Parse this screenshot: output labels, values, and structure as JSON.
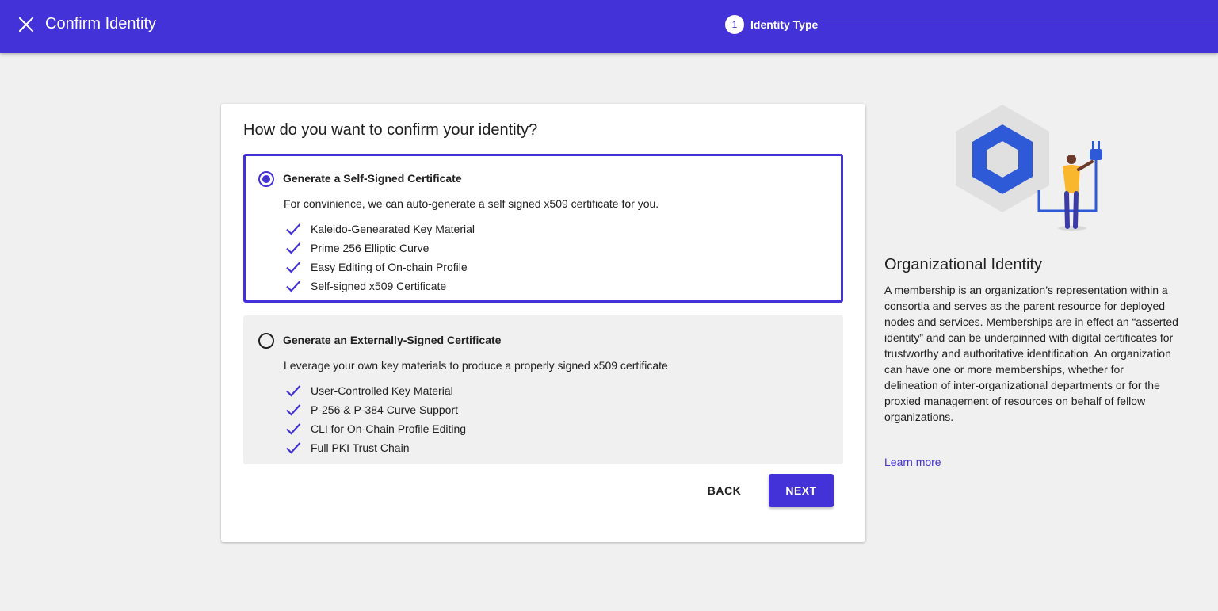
{
  "header": {
    "title": "Confirm Identity",
    "close_icon": "close-icon",
    "step": {
      "number": "1",
      "label": "Identity Type"
    }
  },
  "card": {
    "title": "How do you want to confirm your identity?",
    "options": [
      {
        "title": "Generate a Self-Signed Certificate",
        "description": "For convinience, we can auto-generate a self signed x509 certificate for you.",
        "selected": true,
        "features": [
          "Kaleido-Genearated Key Material",
          "Prime 256 Elliptic Curve",
          "Easy Editing of On-chain Profile",
          "Self-signed x509 Certificate"
        ]
      },
      {
        "title": "Generate an Externally-Signed Certificate",
        "description": "Leverage your own key materials to produce a properly signed x509 certificate",
        "selected": false,
        "features": [
          "User-Controlled Key Material",
          "P-256 & P-384 Curve Support",
          "CLI for On-Chain Profile Editing",
          "Full PKI Trust Chain"
        ]
      }
    ],
    "back_label": "BACK",
    "next_label": "NEXT"
  },
  "sidebar": {
    "title": "Organizational Identity",
    "body": "A membership is an organization’s representation within a consortia and serves as the parent resource for deployed nodes and services. Memberships are in effect an “asserted identity” and can be underpinned with digital certificates for trustworthy and authoritative identification. An organization can have one or more memberships, whether for delineation of inter-organizational departments or for the proxied management of resources on behalf of fellow organizations.",
    "learn_more": "Learn more"
  },
  "colors": {
    "brand": "#4332d7",
    "background": "#f0f0f0",
    "hexagon_outer": "#e0e0e0",
    "hexagon_inner": "#2e5ad8",
    "person_shirt": "#f8b72c"
  }
}
